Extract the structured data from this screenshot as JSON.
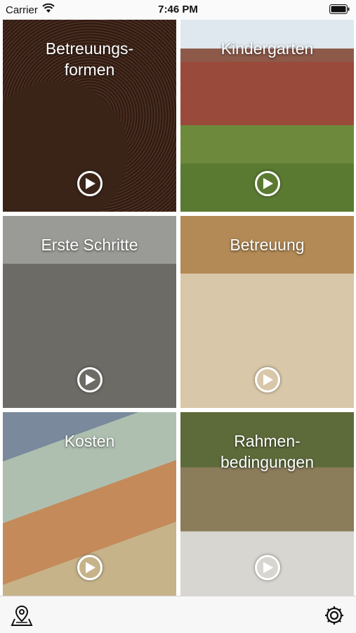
{
  "status_bar": {
    "carrier": "Carrier",
    "time": "7:46 PM"
  },
  "tiles": [
    {
      "title": "Betreuungs-\nformen",
      "icon": "play-icon"
    },
    {
      "title": "Kindergarten",
      "icon": "play-icon"
    },
    {
      "title": "Erste Schritte",
      "icon": "play-icon"
    },
    {
      "title": "Betreuung",
      "icon": "play-icon"
    },
    {
      "title": "Kosten",
      "icon": "play-icon"
    },
    {
      "title": "Rahmen-\nbedingungen",
      "icon": "play-icon"
    }
  ],
  "bottom_bar": {
    "left_icon": "map-pin-icon",
    "right_icon": "gear-icon"
  }
}
